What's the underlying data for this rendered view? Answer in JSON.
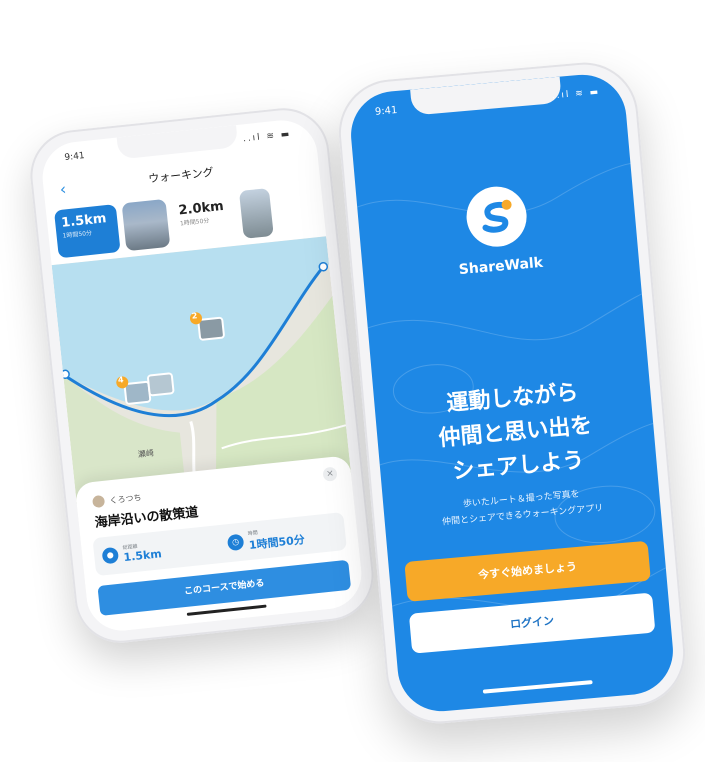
{
  "left_phone": {
    "status": {
      "time": "9:41",
      "icons": "..ıl ≋ ▬"
    },
    "nav": {
      "back": "‹",
      "title": "ウォーキング"
    },
    "routes": [
      {
        "distance": "1.5km",
        "duration": "1時間50分"
      },
      {
        "distance": "2.0km",
        "duration": "1時間50分"
      }
    ],
    "map": {
      "place_label": "瀬崎",
      "markers": [
        "2",
        "4"
      ]
    },
    "sheet": {
      "user": "くろつち",
      "close": "×",
      "course_title": "海岸沿いの散策道",
      "stats": [
        {
          "label": "総距離",
          "value": "1.5km",
          "icon": "footprint-icon"
        },
        {
          "label": "時間",
          "value": "1時間50分",
          "icon": "clock-icon"
        }
      ],
      "start_button": "このコースで始める"
    }
  },
  "right_phone": {
    "status": {
      "time": "9:41",
      "icons": "..ıl ≋ ▬"
    },
    "app_name": "ShareWalk",
    "headline": [
      "運動しながら",
      "仲間と思い出を",
      "シェアしよう"
    ],
    "subline": [
      "歩いたルート＆撮った写真を",
      "仲間とシェアできるウォーキングアプリ"
    ],
    "primary_button": "今すぐ始めましょう",
    "secondary_button": "ログイン"
  },
  "colors": {
    "brand_blue": "#1e88e5",
    "accent_orange": "#f7a928",
    "map_water": "#b7dff0"
  }
}
